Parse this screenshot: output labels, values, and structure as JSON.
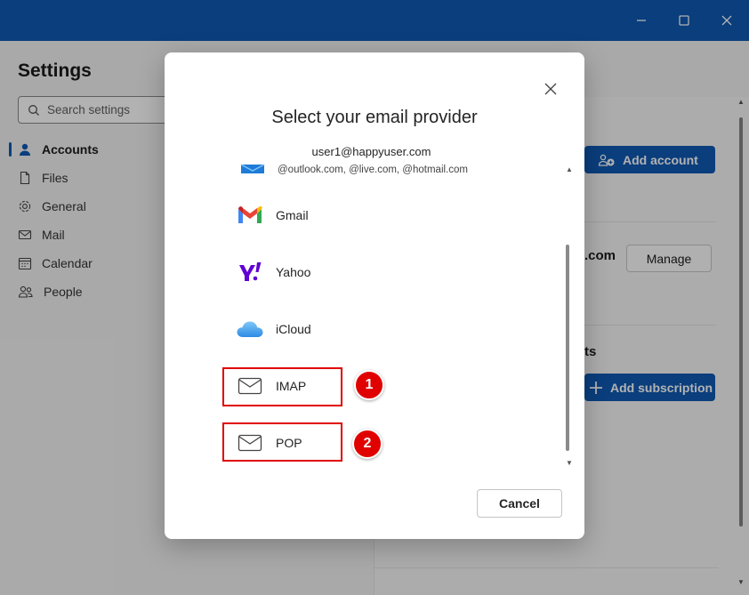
{
  "settings": {
    "title": "Settings",
    "search_placeholder": "Search settings",
    "nav": [
      {
        "label": "Accounts",
        "icon": "person-icon",
        "active": true
      },
      {
        "label": "Files",
        "icon": "file-icon"
      },
      {
        "label": "General",
        "icon": "gear-icon"
      },
      {
        "label": "Mail",
        "icon": "mail-icon"
      },
      {
        "label": "Calendar",
        "icon": "calendar-icon"
      },
      {
        "label": "People",
        "icon": "people-icon"
      }
    ]
  },
  "background": {
    "add_account_label": "Add account",
    "account_suffix": ".com",
    "manage_label": "Manage",
    "section_fragment": "ts",
    "add_subscription_label": "Add subscription"
  },
  "dialog": {
    "title": "Select your email provider",
    "outlook_email": "user1@happyuser.com",
    "outlook_domains": "@outlook.com, @live.com, @hotmail.com",
    "providers": [
      {
        "label": "Gmail",
        "icon": "gmail-icon"
      },
      {
        "label": "Yahoo",
        "icon": "yahoo-icon"
      },
      {
        "label": "iCloud",
        "icon": "icloud-icon"
      },
      {
        "label": "IMAP",
        "icon": "mail-envelope-icon"
      },
      {
        "label": "POP",
        "icon": "mail-envelope-icon"
      }
    ],
    "cancel_label": "Cancel"
  },
  "annotations": [
    {
      "number": "1"
    },
    {
      "number": "2"
    }
  ],
  "colors": {
    "titlebar": "#0f5ab4",
    "primary": "#0f5ab4",
    "highlight": "#e00000"
  }
}
